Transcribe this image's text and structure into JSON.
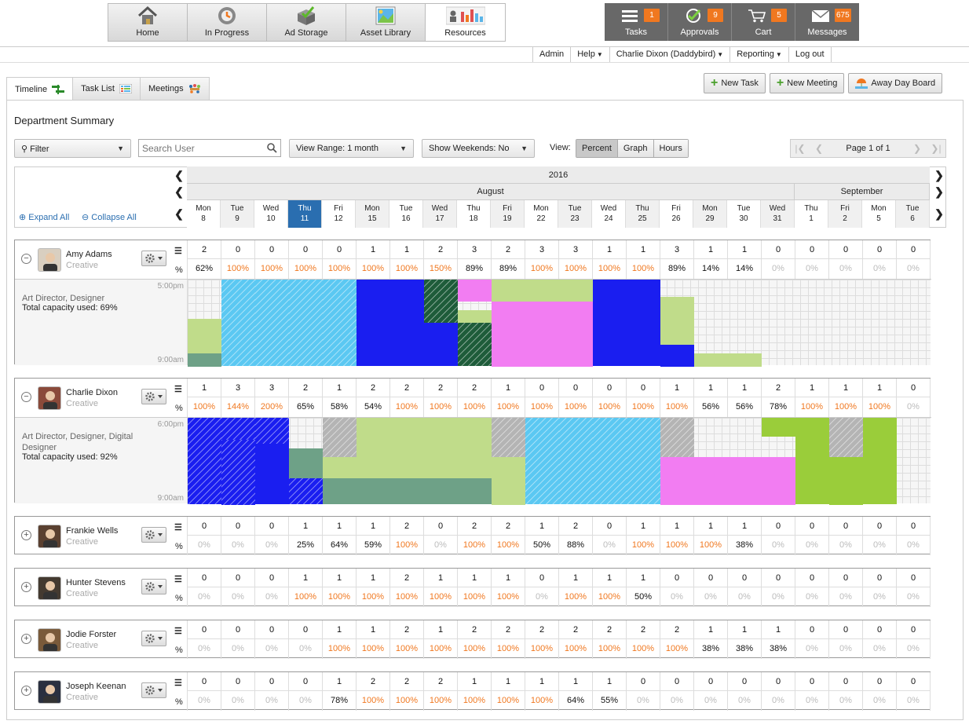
{
  "top_nav": [
    {
      "label": "Home",
      "icon": "home-icon"
    },
    {
      "label": "In Progress",
      "icon": "in-progress-icon"
    },
    {
      "label": "Ad Storage",
      "icon": "ad-storage-icon"
    },
    {
      "label": "Asset Library",
      "icon": "asset-library-icon"
    },
    {
      "label": "Resources",
      "icon": "resources-icon",
      "active": true
    }
  ],
  "right_nav": [
    {
      "label": "Tasks",
      "badge": "1",
      "icon": "tasks-icon"
    },
    {
      "label": "Approvals",
      "badge": "9",
      "icon": "approvals-icon"
    },
    {
      "label": "Cart",
      "badge": "5",
      "icon": "cart-icon"
    },
    {
      "label": "Messages",
      "badge": "675",
      "icon": "messages-icon"
    }
  ],
  "menu": [
    {
      "label": "Admin",
      "caret": false
    },
    {
      "label": "Help",
      "caret": true
    },
    {
      "label": "Charlie Dixon (Daddybird)",
      "caret": true
    },
    {
      "label": "Reporting",
      "caret": true
    },
    {
      "label": "Log out",
      "caret": false
    }
  ],
  "tabs": [
    {
      "label": "Timeline",
      "active": true
    },
    {
      "label": "Task List"
    },
    {
      "label": "Meetings"
    }
  ],
  "actions": {
    "new_task": "New Task",
    "new_meeting": "New Meeting",
    "away_day": "Away Day Board"
  },
  "page_title": "Department Summary",
  "toolbar": {
    "filter": "Filter",
    "search_placeholder": "Search User",
    "view_range": "View Range: 1 month",
    "show_weekends": "Show Weekends: No",
    "view_label": "View:",
    "view_options": [
      "Percent",
      "Graph",
      "Hours"
    ],
    "active_view": "Percent",
    "page_label": "Page 1 of 1"
  },
  "timeline": {
    "expand_all": "Expand All",
    "collapse_all": "Collapse All",
    "year": "2016",
    "months": [
      {
        "label": "August",
        "days": 18
      },
      {
        "label": "September",
        "days": 4
      }
    ],
    "days": [
      {
        "d": "Mon",
        "n": "8"
      },
      {
        "d": "Tue",
        "n": "9"
      },
      {
        "d": "Wed",
        "n": "10"
      },
      {
        "d": "Thu",
        "n": "11",
        "today": true
      },
      {
        "d": "Fri",
        "n": "12"
      },
      {
        "d": "Mon",
        "n": "15"
      },
      {
        "d": "Tue",
        "n": "16"
      },
      {
        "d": "Wed",
        "n": "17"
      },
      {
        "d": "Thu",
        "n": "18"
      },
      {
        "d": "Fri",
        "n": "19"
      },
      {
        "d": "Mon",
        "n": "22"
      },
      {
        "d": "Tue",
        "n": "23"
      },
      {
        "d": "Wed",
        "n": "24"
      },
      {
        "d": "Thu",
        "n": "25"
      },
      {
        "d": "Fri",
        "n": "26"
      },
      {
        "d": "Mon",
        "n": "29"
      },
      {
        "d": "Tue",
        "n": "30"
      },
      {
        "d": "Wed",
        "n": "31"
      },
      {
        "d": "Thu",
        "n": "1"
      },
      {
        "d": "Fri",
        "n": "2"
      },
      {
        "d": "Mon",
        "n": "5"
      },
      {
        "d": "Tue",
        "n": "6"
      }
    ]
  },
  "colors": {
    "light_blue": "#5bc8f2",
    "blue": "#1a1ef0",
    "green_hatched": "#1e5c3a",
    "pink": "#f27df2",
    "light_green": "#c0dc8a",
    "gray_green": "#6ea187",
    "bright_green": "#9acd3a",
    "gray": "#b4b4b4",
    "orange_text": "#f07820",
    "today": "#2a6eb0"
  },
  "people": [
    {
      "name": "Amy Adams",
      "role": "Creative",
      "expanded": true,
      "titles": "Art Director, Designer",
      "capacity": "Total capacity used: 69%",
      "start_time": "9:00am",
      "end_time": "5:00pm",
      "counts": [
        "2",
        "0",
        "0",
        "0",
        "0",
        "1",
        "1",
        "2",
        "3",
        "2",
        "3",
        "3",
        "1",
        "1",
        "3",
        "1",
        "1",
        "0",
        "0",
        "0",
        "0",
        "0"
      ],
      "percents": [
        "62%",
        "100%",
        "100%",
        "100%",
        "100%",
        "100%",
        "100%",
        "150%",
        "89%",
        "89%",
        "100%",
        "100%",
        "100%",
        "100%",
        "89%",
        "14%",
        "14%",
        "0%",
        "0%",
        "0%",
        "0%",
        "0%"
      ]
    },
    {
      "name": "Charlie Dixon",
      "role": "Creative",
      "expanded": true,
      "titles": "Art Director, Designer, Digital Designer",
      "capacity": "Total capacity used: 92%",
      "start_time": "9:00am",
      "end_time": "6:00pm",
      "counts": [
        "1",
        "3",
        "3",
        "2",
        "1",
        "2",
        "2",
        "2",
        "2",
        "1",
        "0",
        "0",
        "0",
        "0",
        "1",
        "1",
        "1",
        "2",
        "1",
        "1",
        "1",
        "0"
      ],
      "percents": [
        "100%",
        "144%",
        "200%",
        "65%",
        "58%",
        "54%",
        "100%",
        "100%",
        "100%",
        "100%",
        "100%",
        "100%",
        "100%",
        "100%",
        "100%",
        "56%",
        "56%",
        "78%",
        "100%",
        "100%",
        "100%",
        "0%"
      ]
    },
    {
      "name": "Frankie Wells",
      "role": "Creative",
      "expanded": false,
      "counts": [
        "0",
        "0",
        "0",
        "1",
        "1",
        "1",
        "2",
        "0",
        "2",
        "2",
        "1",
        "2",
        "0",
        "1",
        "1",
        "1",
        "1",
        "0",
        "0",
        "0",
        "0",
        "0"
      ],
      "percents": [
        "0%",
        "0%",
        "0%",
        "25%",
        "64%",
        "59%",
        "100%",
        "0%",
        "100%",
        "100%",
        "50%",
        "88%",
        "0%",
        "100%",
        "100%",
        "100%",
        "38%",
        "0%",
        "0%",
        "0%",
        "0%",
        "0%"
      ]
    },
    {
      "name": "Hunter Stevens",
      "role": "Creative",
      "expanded": false,
      "counts": [
        "0",
        "0",
        "0",
        "1",
        "1",
        "1",
        "2",
        "1",
        "1",
        "1",
        "0",
        "1",
        "1",
        "1",
        "0",
        "0",
        "0",
        "0",
        "0",
        "0",
        "0",
        "0"
      ],
      "percents": [
        "0%",
        "0%",
        "0%",
        "100%",
        "100%",
        "100%",
        "100%",
        "100%",
        "100%",
        "100%",
        "0%",
        "100%",
        "100%",
        "50%",
        "0%",
        "0%",
        "0%",
        "0%",
        "0%",
        "0%",
        "0%",
        "0%"
      ]
    },
    {
      "name": "Jodie Forster",
      "role": "Creative",
      "expanded": false,
      "counts": [
        "0",
        "0",
        "0",
        "0",
        "1",
        "1",
        "2",
        "1",
        "2",
        "2",
        "2",
        "2",
        "2",
        "2",
        "2",
        "1",
        "1",
        "1",
        "0",
        "0",
        "0",
        "0"
      ],
      "percents": [
        "0%",
        "0%",
        "0%",
        "0%",
        "100%",
        "100%",
        "100%",
        "100%",
        "100%",
        "100%",
        "100%",
        "100%",
        "100%",
        "100%",
        "100%",
        "38%",
        "38%",
        "38%",
        "0%",
        "0%",
        "0%",
        "0%"
      ]
    },
    {
      "name": "Joseph Keenan",
      "role": "Creative",
      "expanded": false,
      "counts": [
        "0",
        "0",
        "0",
        "0",
        "1",
        "2",
        "2",
        "2",
        "1",
        "1",
        "1",
        "1",
        "1",
        "0",
        "0",
        "0",
        "0",
        "0",
        "0",
        "0",
        "0",
        "0"
      ],
      "percents": [
        "0%",
        "0%",
        "0%",
        "0%",
        "78%",
        "100%",
        "100%",
        "100%",
        "100%",
        "100%",
        "100%",
        "64%",
        "55%",
        "0%",
        "0%",
        "0%",
        "0%",
        "0%",
        "0%",
        "0%",
        "0%",
        "0%"
      ]
    }
  ]
}
